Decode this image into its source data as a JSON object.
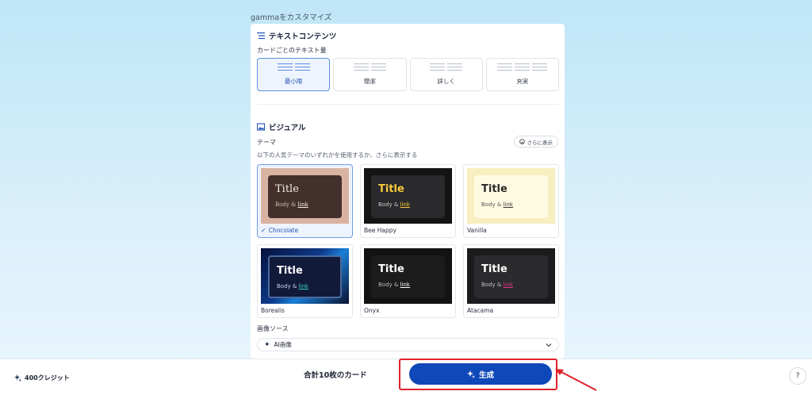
{
  "page_title": "gammaをカスタマイズ",
  "text_section": {
    "heading": "テキストコンテンツ",
    "amount_label": "カードごとのテキスト量",
    "options": [
      {
        "label": "最小限",
        "selected": true
      },
      {
        "label": "簡潔",
        "selected": false
      },
      {
        "label": "詳しく",
        "selected": false
      },
      {
        "label": "充実",
        "selected": false
      }
    ]
  },
  "visual_section": {
    "heading": "ビジュアル",
    "theme_label": "テーマ",
    "theme_description": "以下の人気テーマのいずれかを使用するか、さらに表示する",
    "show_more": "さらに表示",
    "preview_title": "Title",
    "preview_body": "Body & ",
    "preview_link": "link",
    "themes": [
      {
        "name": "Chocolate",
        "selected": true,
        "bg": "#d9b3a1",
        "card": "#43302d",
        "title_color": "#f4ede7",
        "body_color": "#cdbfb5",
        "link_color": "#f4ede7"
      },
      {
        "name": "Bee Happy",
        "selected": false,
        "bg": "#141414",
        "card": "#2a2a2d",
        "title_color": "#f6c93b",
        "body_color": "#c8c8c8",
        "link_color": "#f6c93b"
      },
      {
        "name": "Vanilla",
        "selected": false,
        "bg": "#f7efbf",
        "card": "#fffbe3",
        "title_color": "#2a2a2a",
        "body_color": "#555555",
        "link_color": "#333333"
      },
      {
        "name": "Borealis",
        "selected": false,
        "bg": "#0b1230",
        "card": "#121a3a",
        "title_color": "#ffffff",
        "body_color": "#c9d2e6",
        "link_color": "#38d9c2"
      },
      {
        "name": "Onyx",
        "selected": false,
        "bg": "#121212",
        "card": "#1c1c1c",
        "title_color": "#ffffff",
        "body_color": "#bbbbbb",
        "link_color": "#ffffff"
      },
      {
        "name": "Atacama",
        "selected": false,
        "bg": "#1c1c1e",
        "card": "#2b2b2e",
        "title_color": "#ffffff",
        "body_color": "#c3c3c3",
        "link_color": "#e0358b"
      }
    ],
    "image_source_label": "画像ソース",
    "image_source_value": "AI画像"
  },
  "bottom_bar": {
    "credits": "400クレジット",
    "total_cards": "合計10枚のカード",
    "generate": "生成",
    "help": "?"
  },
  "colors": {
    "primary_button": "#0f48b8",
    "highlight_outline": "#e0212b",
    "selected_border": "#5a8ee0"
  }
}
